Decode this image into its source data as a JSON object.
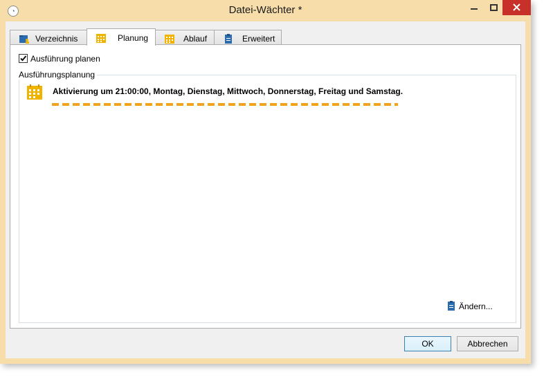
{
  "window": {
    "title": "Datei-Wächter *",
    "app_icon": "document-watcher-icon",
    "controls": [
      "minimize-icon",
      "maximize-icon",
      "close-icon"
    ]
  },
  "tabs": [
    {
      "label": "Verzeichnis",
      "icon": "folder-user-icon",
      "active": false
    },
    {
      "label": "Planung",
      "icon": "calendar-icon",
      "active": true
    },
    {
      "label": "Ablauf",
      "icon": "calendar-icon",
      "active": false
    },
    {
      "label": "Erweitert",
      "icon": "clipboard-icon",
      "active": false
    }
  ],
  "planning": {
    "checkbox_label": "Ausführung planen",
    "checkbox_checked": true,
    "group_label": "Ausführungsplanung",
    "schedule_text": "Aktivierung um 21:00:00, Montag, Dienstag, Mittwoch, Donnerstag, Freitag und Samstag.",
    "change_label": "Ändern..."
  },
  "buttons": {
    "ok": "OK",
    "cancel": "Abbrechen"
  },
  "colors": {
    "window_frame": "#f7ddaa",
    "close_button": "#c7312a",
    "highlight_dash": "#f2a21b",
    "calendar_icon": "#f0b400"
  }
}
